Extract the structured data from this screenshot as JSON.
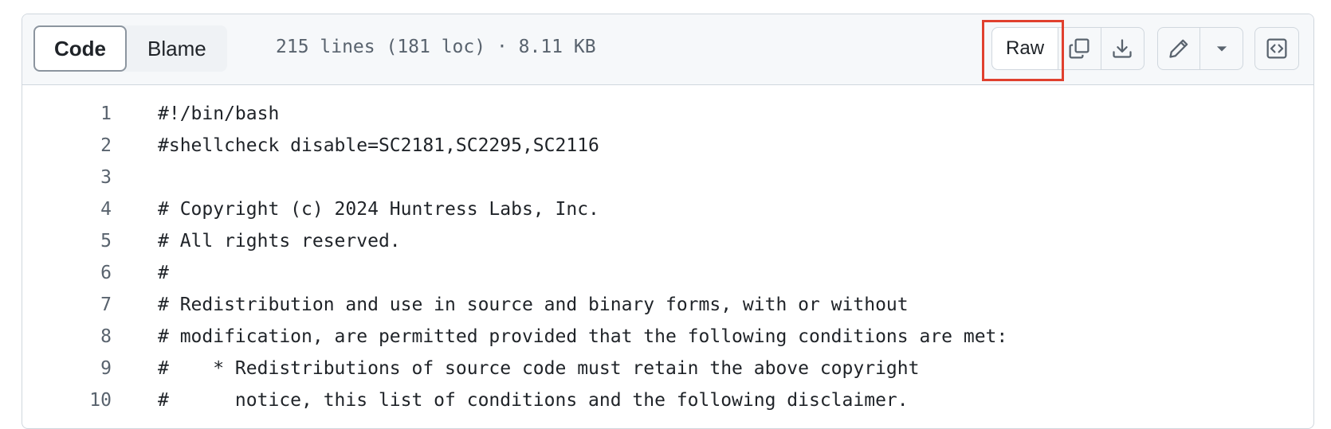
{
  "header": {
    "tabs": [
      {
        "label": "Code",
        "active": true
      },
      {
        "label": "Blame",
        "active": false
      }
    ],
    "file_meta": "215 lines (181 loc) · 8.11 KB",
    "raw_label": "Raw",
    "icons": {
      "copy": "copy-icon",
      "download": "download-icon",
      "edit": "pencil-icon",
      "dropdown": "triangle-down-icon",
      "symbols": "code-square-icon"
    },
    "highlight_color": "#e0402e"
  },
  "code": {
    "lines": [
      {
        "num": "1",
        "text": "#!/bin/bash"
      },
      {
        "num": "2",
        "text": "#shellcheck disable=SC2181,SC2295,SC2116"
      },
      {
        "num": "3",
        "text": ""
      },
      {
        "num": "4",
        "text": "# Copyright (c) 2024 Huntress Labs, Inc."
      },
      {
        "num": "5",
        "text": "# All rights reserved."
      },
      {
        "num": "6",
        "text": "#"
      },
      {
        "num": "7",
        "text": "# Redistribution and use in source and binary forms, with or without"
      },
      {
        "num": "8",
        "text": "# modification, are permitted provided that the following conditions are met:"
      },
      {
        "num": "9",
        "text": "#    * Redistributions of source code must retain the above copyright"
      },
      {
        "num": "10",
        "text": "#      notice, this list of conditions and the following disclaimer."
      }
    ]
  }
}
